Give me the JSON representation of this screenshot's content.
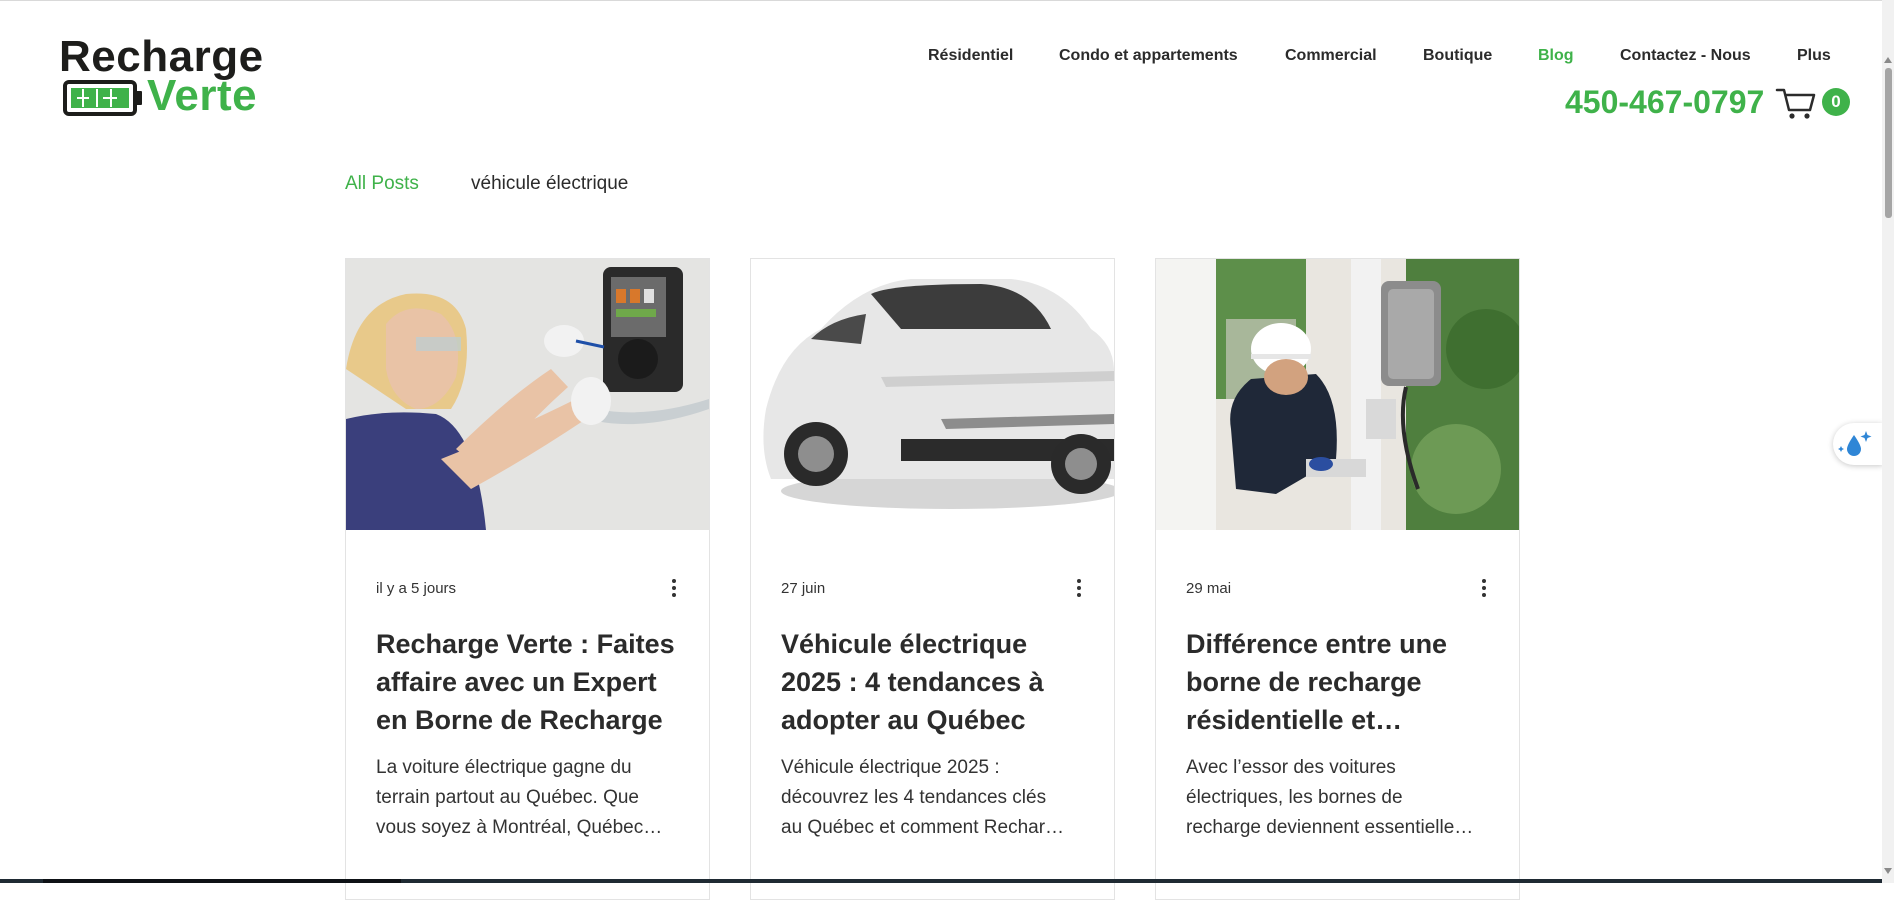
{
  "brand": {
    "name_part1": "Recharge",
    "name_part2": "Verte",
    "primary_color": "#3fb24a",
    "dark_color": "#1d1d1b"
  },
  "nav": {
    "items": [
      {
        "label": "Résidentiel",
        "active": false
      },
      {
        "label": "Condo et appartements",
        "active": false
      },
      {
        "label": "Commercial",
        "active": false
      },
      {
        "label": "Boutique",
        "active": false
      },
      {
        "label": "Blog",
        "active": true
      },
      {
        "label": "Contactez - Nous",
        "active": false
      },
      {
        "label": "Plus",
        "active": false
      }
    ]
  },
  "header": {
    "phone": "450-467-0797",
    "cart_icon": "cart-icon",
    "cart_count": "0"
  },
  "categories": {
    "all": "All Posts",
    "ev": "véhicule électrique"
  },
  "posts": [
    {
      "date": "il y a 5 jours",
      "title": "Recharge Verte : Faites affaire avec un Expert en Borne de Recharge",
      "excerpt_lines": [
        "La voiture électrique gagne du",
        "terrain partout au Québec. Que",
        "vous soyez à Montréal, Québec…"
      ],
      "image": "technician-installing-wall-charger-photo"
    },
    {
      "date": "27 juin",
      "title": "Véhicule électrique 2025 : 4 tendances à adopter au Québec",
      "excerpt_lines": [
        "Véhicule électrique 2025 :",
        "découvrez les 4 tendances clés",
        "au Québec et comment Rechar…"
      ],
      "image": "white-electric-suv-photo"
    },
    {
      "date": "29 mai",
      "title": "Différence entre une borne de recharge résidentielle et…",
      "excerpt_lines": [
        "Avec l’essor des voitures",
        "électriques, les bornes de",
        "recharge deviennent essentielle…"
      ],
      "image": "technician-at-charging-station-photo"
    }
  ],
  "widget": {
    "icon": "water-drop-sparkle-icon"
  }
}
